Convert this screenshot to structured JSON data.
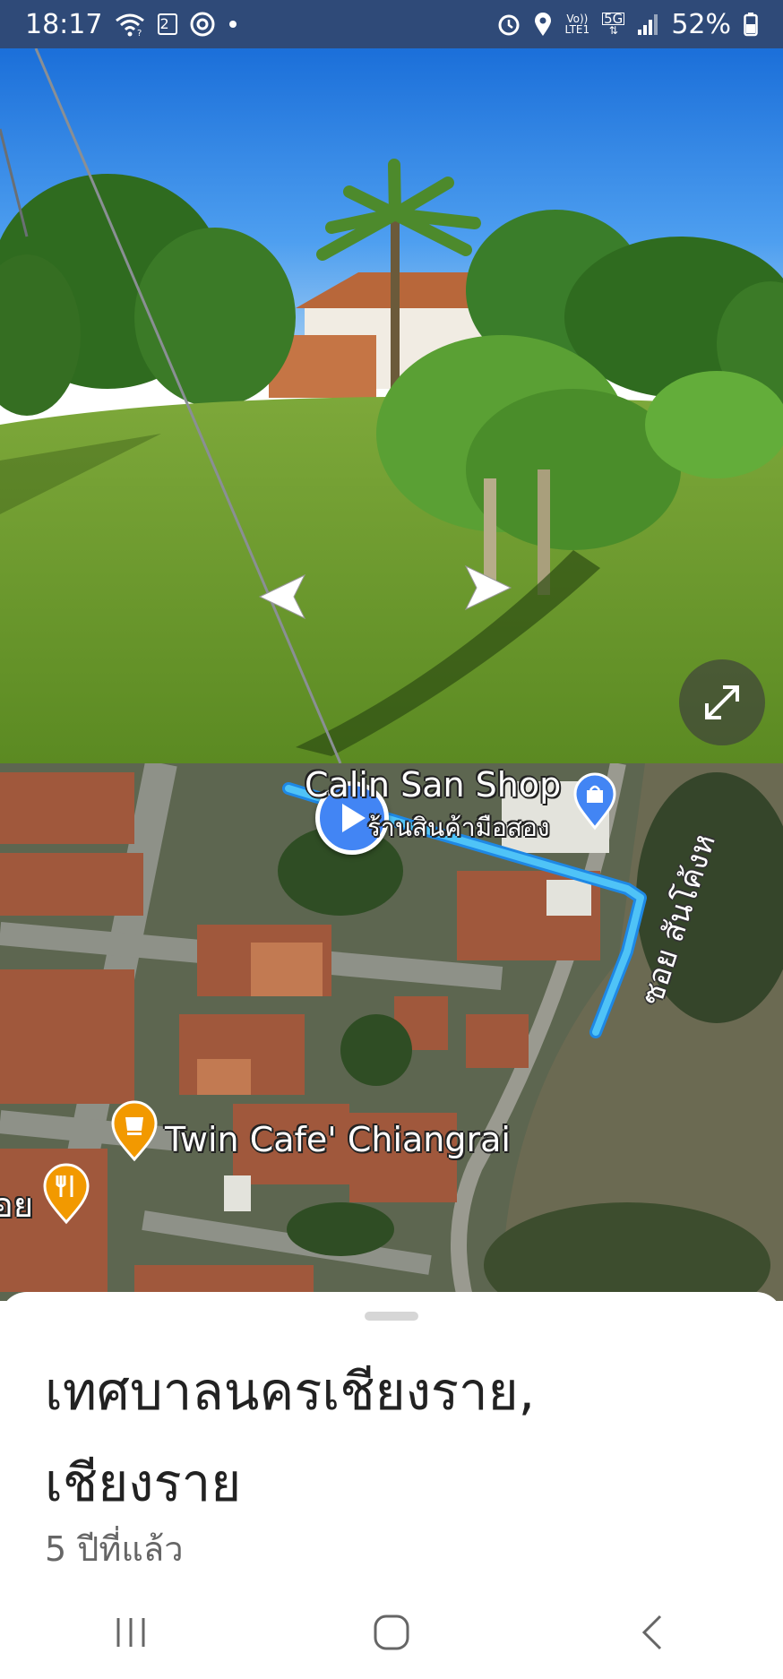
{
  "status_bar": {
    "time": "18:17",
    "notification_count": "2",
    "volte_label": "Vo))",
    "lte_label": "LTE1",
    "network_type": "5G",
    "battery_percent": "52%",
    "icons": [
      "wifi-icon",
      "notification-badge-icon",
      "chrome-icon",
      "dot-icon",
      "alarm-icon",
      "location-icon",
      "volte-icon",
      "5g-icon",
      "signal-icon",
      "battery-icon"
    ]
  },
  "street_view": {
    "nav_left_icon": "chevron-left-icon",
    "nav_right_icon": "chevron-right-icon",
    "expand_icon": "expand-icon"
  },
  "map": {
    "place_labels": {
      "shop_name": "Calin San Shop",
      "shop_subtitle": "ร้านสินค้ามือสอง",
      "cafe_name": "Twin Cafe' Chiangrai",
      "restaurant_partial": "อย",
      "road_name": "ซอย สันโค้งห"
    },
    "colors": {
      "route": "#4fc3f7",
      "shop_pin": "#4285f4",
      "cafe_pin": "#f29900",
      "play_button": "#4285f4"
    }
  },
  "sheet": {
    "title": "เทศบาลนครเชียงราย, เชียงราย",
    "date": "5 ปีที่แล้ว"
  },
  "nav_bar": {
    "recents_icon": "recents-icon",
    "home_icon": "home-icon",
    "back_icon": "back-icon"
  }
}
